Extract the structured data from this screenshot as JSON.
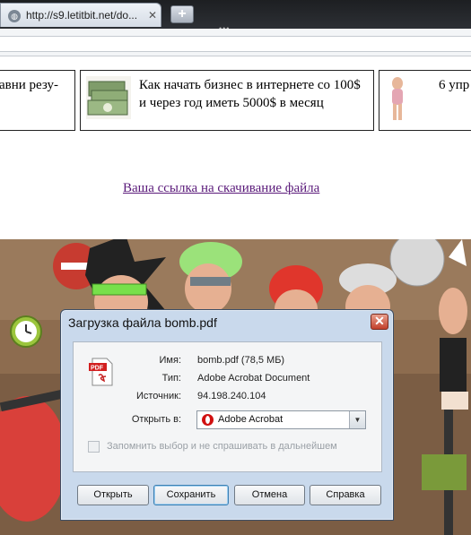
{
  "browser": {
    "tab_title": "http://s9.letitbit.net/do...",
    "tab_favicon": "globe-icon",
    "tab_close": "✕",
    "new_tab": "+"
  },
  "ads": [
    {
      "text": "авни резу-"
    },
    {
      "text": "Как начать бизнес в интернете со 100$ и через год иметь 5000$ в месяц"
    },
    {
      "text": "6 упр"
    }
  ],
  "download_link": "Ваша ссылка на скачивание файла",
  "dialog": {
    "title": "Загрузка файла bomb.pdf",
    "file_icon": "pdf-icon",
    "file_icon_text": "PDF",
    "name_label": "Имя:",
    "name_value": "bomb.pdf (78,5 МБ)",
    "type_label": "Тип:",
    "type_value": "Adobe Acrobat Document",
    "source_label": "Источник:",
    "source_value": "94.198.240.104",
    "open_label": "Открыть в:",
    "open_value": "Adobe Acrobat",
    "remember_label": "Запомнить выбор и не спрашивать в дальнейшем",
    "remember_checked": false,
    "buttons": {
      "open": "Открыть",
      "save": "Сохранить",
      "cancel": "Отмена",
      "help": "Справка"
    }
  },
  "colors": {
    "link": "#5a1a7a",
    "dialog_bg": "#c9d9ec",
    "scene_bg": "#8a6a4d"
  }
}
